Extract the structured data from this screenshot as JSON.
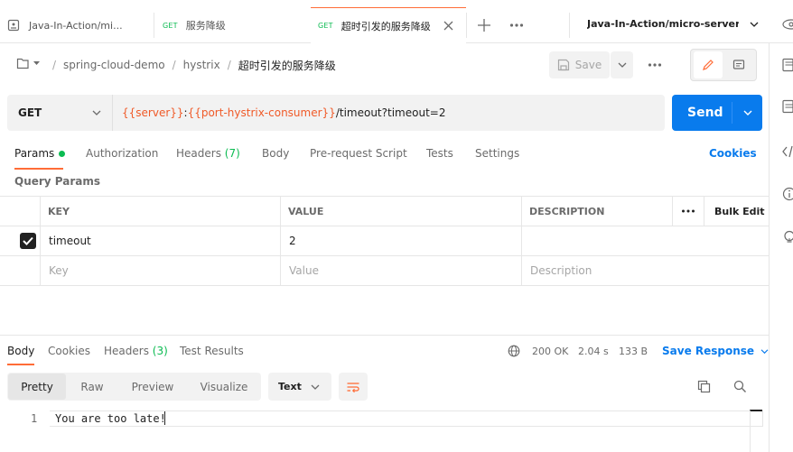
{
  "tabs": [
    {
      "label": "Java-In-Action/mi...",
      "method": ""
    },
    {
      "label": "服务降级",
      "method": "GET"
    },
    {
      "label": "超时引发的服务降级",
      "method": "GET"
    }
  ],
  "workspace_path": "Java-In-Action/micro-server/sp",
  "breadcrumb": {
    "collection": "spring-cloud-demo",
    "folder": "hystrix",
    "request": "超时引发的服务降级"
  },
  "toolbar": {
    "save": "Save"
  },
  "request": {
    "method": "GET",
    "url_var1": "{{server}}",
    "url_colon": ":",
    "url_var2": "{{port-hystrix-consumer}}",
    "url_path": "/timeout?timeout=2",
    "send": "Send"
  },
  "param_tabs": {
    "params": "Params",
    "authorization": "Authorization",
    "headers": "Headers",
    "headers_count": "(7)",
    "body": "Body",
    "prerequest": "Pre-request Script",
    "tests": "Tests",
    "settings": "Settings",
    "cookies": "Cookies"
  },
  "query_params": {
    "title": "Query Params",
    "headers": {
      "key": "KEY",
      "value": "VALUE",
      "description": "DESCRIPTION",
      "bulk_edit": "Bulk Edit"
    },
    "rows": [
      {
        "key": "timeout",
        "value": "2",
        "description": "",
        "checked": true
      }
    ],
    "placeholder": {
      "key": "Key",
      "value": "Value",
      "description": "Description"
    }
  },
  "response": {
    "tabs": {
      "body": "Body",
      "cookies": "Cookies",
      "headers": "Headers",
      "headers_count": "(3)",
      "test_results": "Test Results"
    },
    "status": "200 OK",
    "time": "2.04 s",
    "size": "133 B",
    "save_response": "Save Response",
    "views": {
      "pretty": "Pretty",
      "raw": "Raw",
      "preview": "Preview",
      "visualize": "Visualize"
    },
    "format": "Text",
    "line_number": "1",
    "body_text": "You are too late!"
  },
  "colors": {
    "accent": "#ff6c37",
    "send": "#097bed",
    "status_ok": "#0cbb52",
    "variable": "#f05a28"
  }
}
